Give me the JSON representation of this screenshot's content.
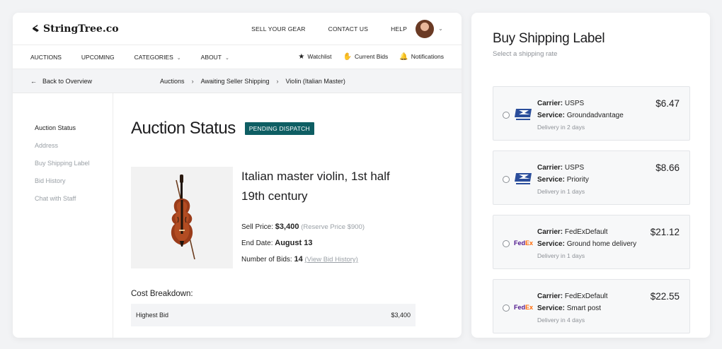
{
  "header": {
    "logo": "StringTree.co",
    "links": [
      "SELL YOUR GEAR",
      "CONTACT US",
      "HELP"
    ]
  },
  "nav": {
    "left": [
      {
        "label": "AUCTIONS",
        "dropdown": false
      },
      {
        "label": "UPCOMING",
        "dropdown": false
      },
      {
        "label": "CATEGORIES",
        "dropdown": true
      },
      {
        "label": "ABOUT",
        "dropdown": true
      }
    ],
    "right": [
      {
        "label": "Watchlist",
        "icon": "star-icon"
      },
      {
        "label": "Current Bids",
        "icon": "hand-icon"
      },
      {
        "label": "Notifications",
        "icon": "bell-icon"
      }
    ]
  },
  "breadcrumb": {
    "back": "Back to Overview",
    "items": [
      "Auctions",
      "Awaiting Seller Shipping",
      "Violin (Italian Master)"
    ]
  },
  "sidebar": {
    "items": [
      "Auction Status",
      "Address",
      "Buy Shipping Label",
      "Bid History",
      "Chat with Staff"
    ],
    "active_index": 0
  },
  "auction": {
    "title": "Auction Status",
    "badge": "PENDING DISPATCH",
    "product_title": "Italian master violin, 1st half 19th century",
    "sell_price_label": "Sell Price:",
    "sell_price": "$3,400",
    "reserve_price": "(Reserve Price $900)",
    "end_date_label": "End Date:",
    "end_date": "August 13",
    "bids_label": "Number of Bids:",
    "bids": "14",
    "bid_history_link": "(View Bid History)",
    "cost_title": "Cost Breakdown:",
    "cost_rows": [
      {
        "label": "Highest Bid",
        "value": "$3,400"
      }
    ]
  },
  "shipping": {
    "title": "Buy Shipping Label",
    "subtitle": "Select a shipping rate",
    "carrier_label": "Carrier:",
    "service_label": "Service:",
    "rates": [
      {
        "carrier": "USPS",
        "service": "Groundadvantage",
        "delivery": "Delivery in 2 days",
        "price": "$6.47",
        "logo": "usps"
      },
      {
        "carrier": "USPS",
        "service": "Priority",
        "delivery": "Delivery in 1 days",
        "price": "$8.66",
        "logo": "usps"
      },
      {
        "carrier": "FedExDefault",
        "service": "Ground home delivery",
        "delivery": "Delivery in 1 days",
        "price": "$21.12",
        "logo": "fedex"
      },
      {
        "carrier": "FedExDefault",
        "service": "Smart post",
        "delivery": "Delivery in 4 days",
        "price": "$22.55",
        "logo": "fedex"
      }
    ],
    "fedex_fed": "Fed",
    "fedex_ex": "Ex"
  },
  "colors": {
    "badge": "#0e5e63",
    "fedex_purple": "#4d148c",
    "fedex_orange": "#ff6600",
    "usps_blue": "#2a4d9b"
  }
}
